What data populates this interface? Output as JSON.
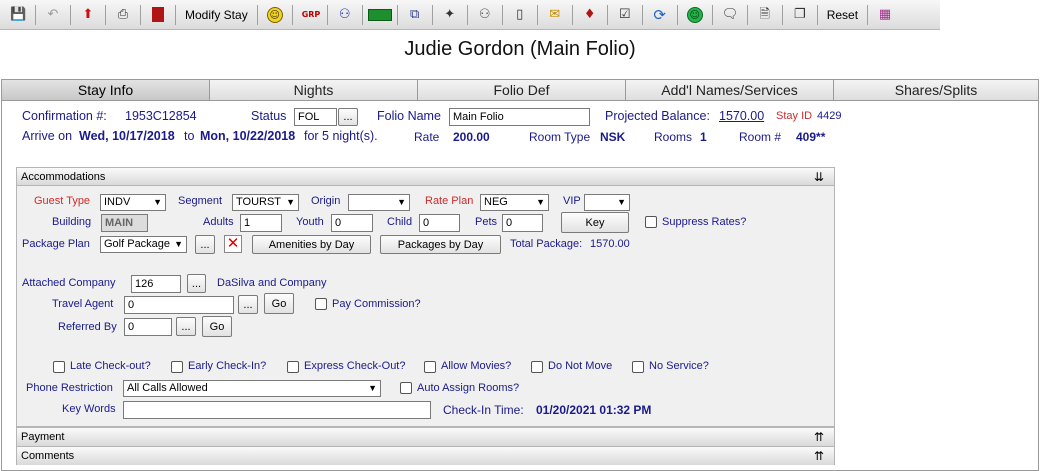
{
  "toolbar": {
    "modify_stay_label": "Modify Stay",
    "reset_label": "Reset",
    "icons": [
      "save-icon",
      "undo-icon",
      "check-in-icon",
      "print-icon",
      "book-icon",
      "smiley-gold-icon",
      "grp-icon",
      "people-icon",
      "money-icon",
      "copy-icon",
      "magic-icon",
      "bell-icon",
      "card-icon",
      "mail-icon",
      "tag-icon",
      "checklist-icon",
      "refresh-icon",
      "smiley-green-icon",
      "chat-icon",
      "document-icon",
      "pages-icon",
      "book-pink-icon"
    ]
  },
  "page_title": "Judie Gordon (Main Folio)",
  "tabs": [
    {
      "label": "Stay Info"
    },
    {
      "label": "Nights"
    },
    {
      "label": "Folio Def"
    },
    {
      "label": "Add'l Names/Services"
    },
    {
      "label": "Shares/Splits"
    }
  ],
  "stay": {
    "confirmation_label": "Confirmation #:",
    "confirmation_value": "1953C12854",
    "status_label": "Status",
    "status_value": "FOL",
    "ellipsis": "...",
    "folio_name_label": "Folio Name",
    "folio_name_value": "Main Folio",
    "projected_balance_label": "Projected Balance:",
    "projected_balance_value": "1570.00",
    "stay_id_label": "Stay ID",
    "stay_id_value": "4429",
    "arrive_label": "Arrive on",
    "arrive_value": "Wed, 10/17/2018",
    "to_label": "to",
    "depart_value": "Mon, 10/22/2018",
    "for_label": "for 5 night(s).",
    "rate_label": "Rate",
    "rate_value": "200.00",
    "room_type_label": "Room Type",
    "room_type_value": "NSK",
    "rooms_label": "Rooms",
    "rooms_value": "1",
    "room_no_label": "Room #",
    "room_no_value": "409**"
  },
  "accommodations": {
    "title": "Accommodations",
    "guest_type_label": "Guest Type",
    "guest_type_value": "INDV",
    "segment_label": "Segment",
    "segment_value": "TOURST",
    "origin_label": "Origin",
    "origin_value": "",
    "rate_plan_label": "Rate Plan",
    "rate_plan_value": "NEG",
    "vip_label": "VIP",
    "vip_value": "",
    "building_label": "Building",
    "building_value": "MAIN",
    "adults_label": "Adults",
    "adults_value": "1",
    "youth_label": "Youth",
    "youth_value": "0",
    "child_label": "Child",
    "child_value": "0",
    "pets_label": "Pets",
    "pets_value": "0",
    "key_button": "Key",
    "suppress_rates_label": "Suppress Rates?",
    "package_plan_label": "Package Plan",
    "package_plan_value": "Golf Package",
    "amenities_button": "Amenities by Day",
    "packages_button": "Packages by Day",
    "total_package_label": "Total Package:",
    "total_package_value": "1570.00",
    "attached_company_label": "Attached Company",
    "attached_company_value": "126",
    "company_name": "DaSilva and Company",
    "travel_agent_label": "Travel Agent",
    "travel_agent_value": "0",
    "go_button": "Go",
    "pay_commission_label": "Pay Commission?",
    "referred_by_label": "Referred By",
    "referred_by_value": "0",
    "late_checkout_label": "Late Check-out?",
    "early_checkin_label": "Early Check-In?",
    "express_checkout_label": "Express Check-Out?",
    "allow_movies_label": "Allow Movies?",
    "do_not_move_label": "Do Not Move",
    "no_service_label": "No Service?",
    "phone_restriction_label": "Phone Restriction",
    "phone_restriction_value": "All Calls Allowed",
    "auto_assign_label": "Auto Assign Rooms?",
    "key_words_label": "Key Words",
    "key_words_value": "",
    "checkin_time_label": "Check-In Time:",
    "checkin_time_value": "01/20/2021 01:32 PM"
  },
  "sections": {
    "payment": "Payment",
    "comments": "Comments"
  }
}
